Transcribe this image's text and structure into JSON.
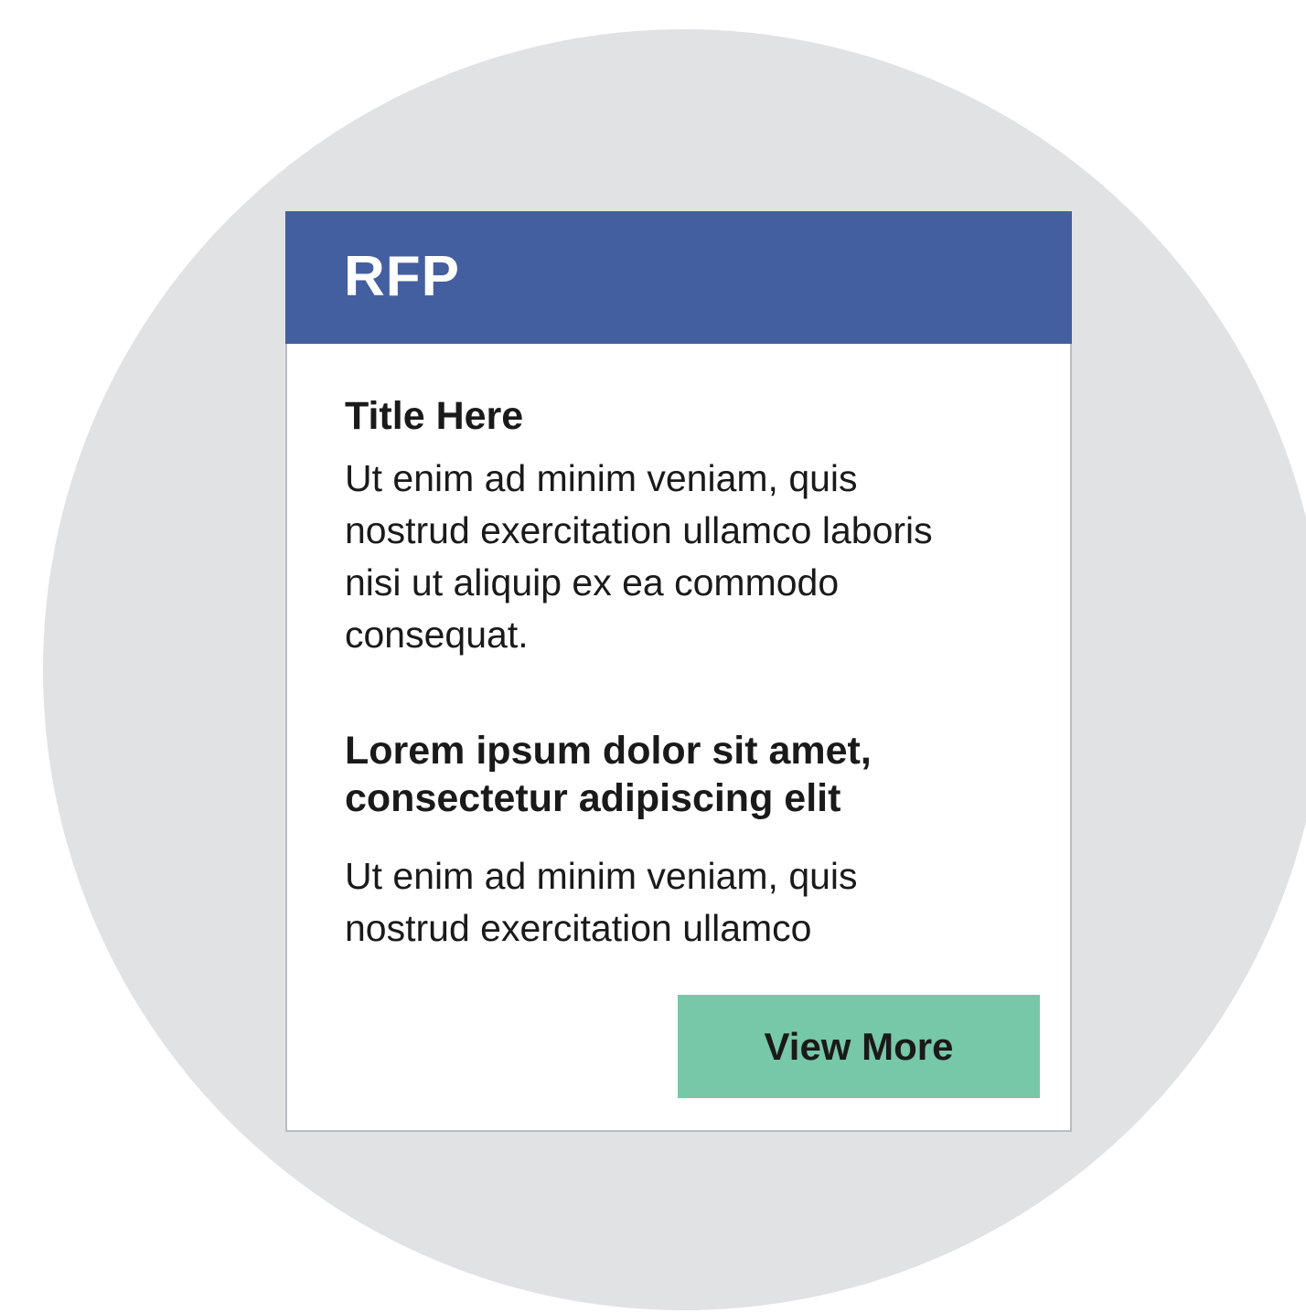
{
  "card": {
    "header_title": "RFP",
    "sections": [
      {
        "title": "Title Here",
        "body": "Ut enim ad minim veniam, quis nostrud exercitation ullamco laboris nisi ut aliquip ex ea commodo consequat."
      },
      {
        "title": "Lorem ipsum dolor sit amet, consectetur adipiscing elit",
        "body": "Ut enim ad minim veniam, quis nostrud exercitation ullamco"
      }
    ],
    "button_label": "View More"
  },
  "colors": {
    "header": "#435f9f",
    "button": "#77c8a8",
    "backdrop": "#e1e2e4",
    "text": "#1a1a1a"
  }
}
